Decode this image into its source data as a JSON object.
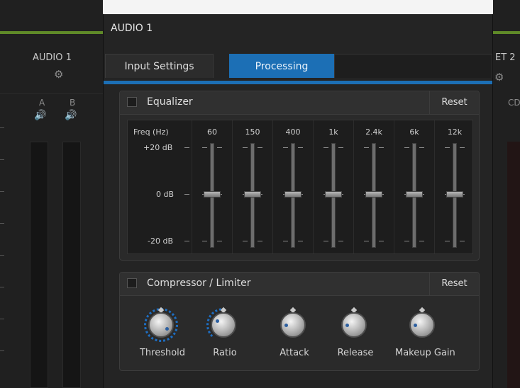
{
  "background_strip": {
    "left_channel": {
      "title": "AUDIO 1",
      "sub_a": "A",
      "sub_b": "B"
    },
    "right_channel_partial": {
      "title": "ET 2",
      "sub": "CD"
    }
  },
  "panel": {
    "title": "AUDIO 1",
    "tabs": [
      {
        "label": "Input Settings",
        "active": false
      },
      {
        "label": "Processing",
        "active": true
      }
    ],
    "equalizer": {
      "label": "Equalizer",
      "enabled": false,
      "reset_label": "Reset",
      "freq_header": "Freq (Hz)",
      "db_labels": {
        "top": "+20 dB",
        "mid": "0 dB",
        "bottom": "-20 dB"
      },
      "bands": [
        {
          "freq": "60",
          "gain_db": 0
        },
        {
          "freq": "150",
          "gain_db": 0
        },
        {
          "freq": "400",
          "gain_db": 0
        },
        {
          "freq": "1k",
          "gain_db": 0
        },
        {
          "freq": "2.4k",
          "gain_db": 0
        },
        {
          "freq": "6k",
          "gain_db": 0
        },
        {
          "freq": "12k",
          "gain_db": 0
        }
      ]
    },
    "compressor": {
      "label": "Compressor / Limiter",
      "enabled": false,
      "reset_label": "Reset",
      "knobs": [
        {
          "label": "Threshold",
          "level": 0.95
        },
        {
          "label": "Ratio",
          "level": 0.3
        },
        {
          "label": "Attack",
          "level": 0.15
        },
        {
          "label": "Release",
          "level": 0.15
        },
        {
          "label": "Makeup Gain",
          "level": 0.15
        }
      ]
    }
  },
  "colors": {
    "accent": "#1c6fb5",
    "green_bar": "#5f8a28",
    "panel_bg": "#242424"
  }
}
